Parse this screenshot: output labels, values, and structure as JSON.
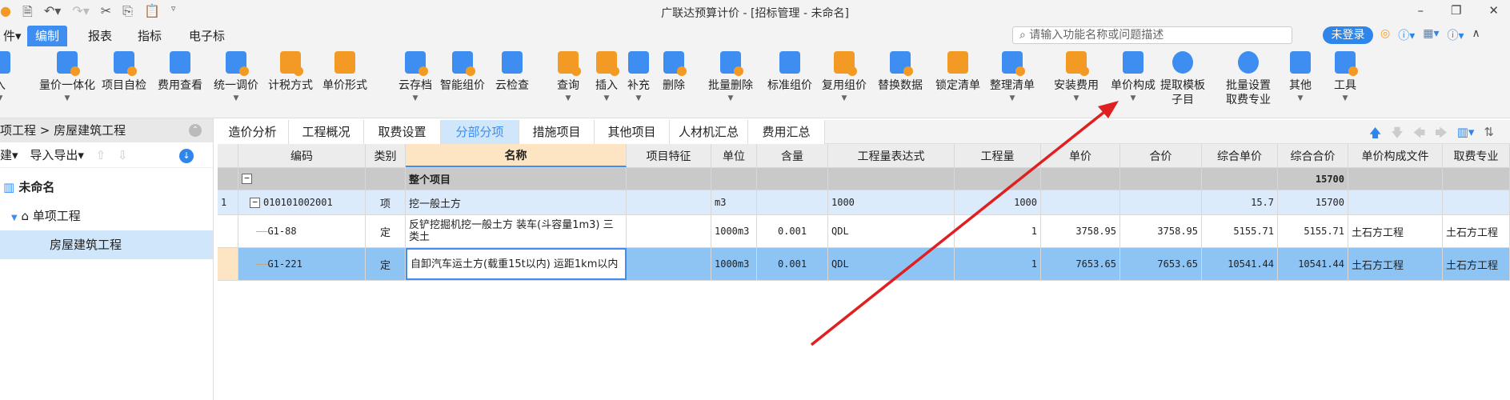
{
  "title": "广联达预算计价 - [招标管理 - 未命名]",
  "menu": {
    "file": "件▾",
    "tabs": [
      "编制",
      "报表",
      "指标",
      "电子标"
    ]
  },
  "search": {
    "placeholder": "请输入功能名称或问题描述"
  },
  "login": "未登录",
  "toolbar": [
    {
      "label": "入",
      "dd": true
    },
    {
      "label": "量价一体化",
      "dd": true
    },
    {
      "label": "项目自检"
    },
    {
      "label": "费用查看"
    },
    {
      "label": "统一调价",
      "dd": true
    },
    {
      "label": "计税方式"
    },
    {
      "label": "单价形式"
    },
    {
      "label": "云存档",
      "dd": true
    },
    {
      "label": "智能组价"
    },
    {
      "label": "云检查"
    },
    {
      "label": "查询",
      "dd": true
    },
    {
      "label": "插入",
      "dd": true
    },
    {
      "label": "补充",
      "dd": true
    },
    {
      "label": "删除"
    },
    {
      "label": "批量删除",
      "dd": true
    },
    {
      "label": "标准组价"
    },
    {
      "label": "复用组价",
      "dd": true
    },
    {
      "label": "替换数据"
    },
    {
      "label": "锁定清单"
    },
    {
      "label": "整理清单",
      "dd": true
    },
    {
      "label": "安装费用",
      "dd": true
    },
    {
      "label": "单价构成",
      "dd": true
    },
    {
      "label": "提取模板",
      "label2": "子目"
    },
    {
      "label": "批量设置",
      "label2": "取费专业"
    },
    {
      "label": "其他",
      "dd": true
    },
    {
      "label": "工具",
      "dd": true
    }
  ],
  "sidebar": {
    "breadcrumb": "项工程 > 房屋建筑工程",
    "new": "建▾",
    "import_export": "导入导出▾",
    "tree": [
      "未命名",
      "单项工程",
      "房屋建筑工程"
    ]
  },
  "tabs": [
    "造价分析",
    "工程概况",
    "取费设置",
    "分部分项",
    "措施项目",
    "其他项目",
    "人材机汇总",
    "费用汇总"
  ],
  "grid": {
    "headers": [
      "编码",
      "类别",
      "名称",
      "项目特征",
      "单位",
      "含量",
      "工程量表达式",
      "工程量",
      "单价",
      "合价",
      "综合单价",
      "综合合价",
      "单价构成文件",
      "取费专业"
    ],
    "rows": [
      {
        "num": "",
        "code": "",
        "type": "",
        "name": "整个项目",
        "feature": "",
        "unit": "",
        "content": "",
        "expr": "",
        "qty": "",
        "price": "",
        "total": "",
        "cprice": "",
        "ctotal": "15700",
        "file": "",
        "spec": ""
      },
      {
        "num": "1",
        "code": "010101002001",
        "type": "项",
        "name": "挖一般土方",
        "feature": "",
        "unit": "m3",
        "content": "",
        "expr": "1000",
        "qty": "1000",
        "price": "",
        "total": "",
        "cprice": "15.7",
        "ctotal": "15700",
        "file": "",
        "spec": ""
      },
      {
        "num": "",
        "code": "G1-88",
        "type": "定",
        "name": "反铲挖掘机挖一般土方 装车(斗容量1m3) 三类土",
        "feature": "",
        "unit": "1000m3",
        "content": "0.001",
        "expr": "QDL",
        "qty": "1",
        "price": "3758.95",
        "total": "3758.95",
        "cprice": "5155.71",
        "ctotal": "5155.71",
        "file": "土石方工程",
        "spec": "土石方工程"
      },
      {
        "num": "",
        "code": "G1-221",
        "type": "定",
        "name": "自卸汽车运土方(载重15t以内) 运距1km以内",
        "feature": "",
        "unit": "1000m3",
        "content": "0.001",
        "expr": "QDL",
        "qty": "1",
        "price": "7653.65",
        "total": "7653.65",
        "cprice": "10541.44",
        "ctotal": "10541.44",
        "file": "土石方工程",
        "spec": "土石方工程"
      }
    ]
  },
  "colors": {
    "accent": "#3d8ef0",
    "selected_row": "#8ec4f3",
    "annotation_arrow": "#e02020"
  }
}
